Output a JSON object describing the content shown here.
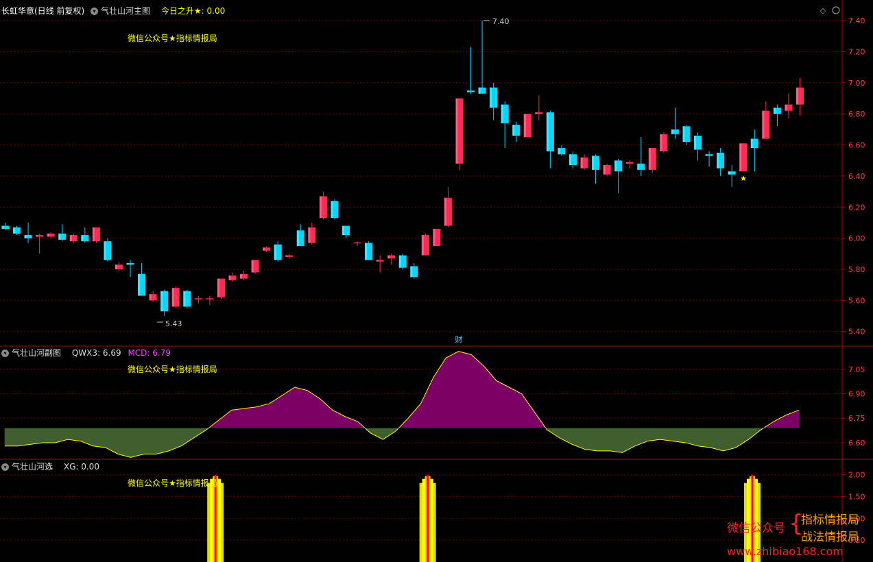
{
  "main_panel": {
    "stock_title": "长虹华意(日线 前复权)",
    "indicator_name": "气壮山河主图",
    "readout_label": "今日之升★:",
    "readout_value": "0.00",
    "watermark": "微信公众号★指标情报局",
    "finance_badge": "财",
    "high_label": "7.40",
    "low_label": "5.43",
    "y_ticks": [
      "7.40",
      "7.20",
      "7.00",
      "6.80",
      "6.60",
      "6.40",
      "6.20",
      "6.00",
      "5.80",
      "5.60",
      "5.40"
    ]
  },
  "sub_panel": {
    "indicator_name": "气壮山河副图",
    "qwx3_label": "QWX3:",
    "qwx3_value": "6.69",
    "mcd_label": "MCD:",
    "mcd_value": "6.79",
    "watermark": "微信公众号★指标情报局",
    "y_ticks": [
      "7.05",
      "6.90",
      "6.75",
      "6.60"
    ]
  },
  "select_panel": {
    "indicator_name": "气壮山河选",
    "xg_label": "XG:",
    "xg_value": "0.00",
    "watermark": "微信公众号★指标情报局",
    "y_ticks": [
      "2.00",
      "1.50",
      "1.00",
      "0.50"
    ]
  },
  "brand": {
    "left": "微信公众号",
    "brace": "{",
    "line1": "指标情报局",
    "line2": "战法情报局",
    "url": "www.zhibiao168.com"
  },
  "colors": {
    "up": "#ff2a55",
    "down": "#00d8ff",
    "green": "#00c000",
    "yellow": "#ffff00",
    "magenta": "#ff40ff",
    "area_up": "#7a0066",
    "area_down": "#3f5f2e",
    "panel_border": "#b00000"
  },
  "chart_data": [
    {
      "type": "candlestick",
      "title": "长虹华意(日线 前复权)",
      "ylim": [
        5.35,
        7.48
      ],
      "ohlc": [
        [
          6.08,
          6.1,
          6.05,
          6.06
        ],
        [
          6.07,
          6.08,
          6.02,
          6.03
        ],
        [
          6.02,
          6.1,
          5.97,
          6.0
        ],
        [
          6.01,
          6.03,
          5.9,
          6.02
        ],
        [
          6.01,
          6.04,
          6.0,
          6.03
        ],
        [
          6.03,
          6.09,
          5.98,
          5.99
        ],
        [
          5.98,
          6.03,
          5.97,
          6.02
        ],
        [
          6.02,
          6.07,
          5.97,
          5.98
        ],
        [
          5.98,
          6.07,
          5.97,
          6.07
        ],
        [
          5.98,
          6.0,
          5.85,
          5.86
        ],
        [
          5.8,
          5.85,
          5.79,
          5.83
        ],
        [
          5.84,
          5.86,
          5.75,
          5.83
        ],
        [
          5.77,
          5.84,
          5.63,
          5.63
        ],
        [
          5.6,
          5.66,
          5.59,
          5.64
        ],
        [
          5.66,
          5.67,
          5.5,
          5.53
        ],
        [
          5.56,
          5.69,
          5.55,
          5.68
        ],
        [
          5.66,
          5.67,
          5.55,
          5.56
        ],
        [
          5.61,
          5.63,
          5.58,
          5.61
        ],
        [
          5.61,
          5.63,
          5.57,
          5.61
        ],
        [
          5.62,
          5.74,
          5.61,
          5.74
        ],
        [
          5.73,
          5.78,
          5.72,
          5.76
        ],
        [
          5.74,
          5.79,
          5.73,
          5.77
        ],
        [
          5.78,
          5.86,
          5.77,
          5.86
        ],
        [
          5.92,
          5.95,
          5.91,
          5.94
        ],
        [
          5.96,
          5.98,
          5.85,
          5.86
        ],
        [
          5.88,
          5.9,
          5.87,
          5.89
        ],
        [
          6.05,
          6.09,
          5.95,
          5.95
        ],
        [
          5.97,
          6.1,
          5.96,
          6.07
        ],
        [
          6.13,
          6.3,
          6.12,
          6.27
        ],
        [
          6.24,
          6.25,
          6.12,
          6.13
        ],
        [
          6.08,
          6.08,
          6.0,
          6.02
        ],
        [
          5.97,
          5.98,
          5.95,
          5.97
        ],
        [
          5.97,
          5.98,
          5.86,
          5.86
        ],
        [
          5.85,
          5.89,
          5.78,
          5.86
        ],
        [
          5.87,
          5.9,
          5.83,
          5.89
        ],
        [
          5.89,
          5.9,
          5.8,
          5.81
        ],
        [
          5.82,
          5.84,
          5.74,
          5.75
        ],
        [
          5.89,
          6.03,
          5.89,
          6.02
        ],
        [
          5.95,
          6.06,
          5.95,
          6.06
        ],
        [
          6.08,
          6.33,
          6.07,
          6.26
        ],
        [
          6.48,
          6.9,
          6.44,
          6.9
        ],
        [
          6.95,
          7.23,
          6.93,
          6.94
        ],
        [
          6.97,
          7.4,
          6.96,
          6.93
        ],
        [
          6.97,
          7.0,
          6.76,
          6.84
        ],
        [
          6.86,
          6.88,
          6.58,
          6.74
        ],
        [
          6.73,
          6.75,
          6.62,
          6.66
        ],
        [
          6.65,
          6.8,
          6.65,
          6.8
        ],
        [
          6.8,
          6.92,
          6.76,
          6.81
        ],
        [
          6.81,
          6.82,
          6.45,
          6.56
        ],
        [
          6.58,
          6.6,
          6.53,
          6.54
        ],
        [
          6.54,
          6.56,
          6.45,
          6.47
        ],
        [
          6.45,
          6.54,
          6.44,
          6.52
        ],
        [
          6.53,
          6.54,
          6.35,
          6.44
        ],
        [
          6.41,
          6.48,
          6.4,
          6.47
        ],
        [
          6.5,
          6.51,
          6.29,
          6.43
        ],
        [
          6.48,
          6.5,
          6.45,
          6.49
        ],
        [
          6.48,
          6.65,
          6.4,
          6.44
        ],
        [
          6.44,
          6.58,
          6.42,
          6.58
        ],
        [
          6.56,
          6.68,
          6.55,
          6.67
        ],
        [
          6.7,
          6.84,
          6.64,
          6.67
        ],
        [
          6.72,
          6.73,
          6.6,
          6.62
        ],
        [
          6.66,
          6.68,
          6.5,
          6.57
        ],
        [
          6.54,
          6.56,
          6.46,
          6.53
        ],
        [
          6.55,
          6.58,
          6.4,
          6.45
        ],
        [
          6.43,
          6.47,
          6.33,
          6.41
        ],
        [
          6.43,
          6.6,
          6.43,
          6.61
        ],
        [
          6.64,
          6.7,
          6.43,
          6.58
        ],
        [
          6.64,
          6.88,
          6.64,
          6.82
        ],
        [
          6.84,
          6.86,
          6.72,
          6.8
        ],
        [
          6.82,
          6.93,
          6.77,
          6.86
        ],
        [
          6.86,
          7.03,
          6.79,
          6.97
        ]
      ]
    },
    {
      "type": "area",
      "title": "气壮山河副图",
      "ylim": [
        6.52,
        7.15
      ],
      "baseline": 6.69,
      "series": [
        {
          "name": "MCD",
          "values": [
            6.58,
            6.58,
            6.59,
            6.6,
            6.6,
            6.62,
            6.61,
            6.58,
            6.57,
            6.53,
            6.51,
            6.53,
            6.53,
            6.55,
            6.58,
            6.63,
            6.68,
            6.74,
            6.8,
            6.81,
            6.82,
            6.84,
            6.89,
            6.94,
            6.92,
            6.87,
            6.8,
            6.76,
            6.73,
            6.66,
            6.62,
            6.67,
            6.75,
            6.84,
            7.0,
            7.12,
            7.16,
            7.14,
            7.07,
            6.98,
            6.94,
            6.9,
            6.79,
            6.68,
            6.63,
            6.59,
            6.56,
            6.55,
            6.55,
            6.54,
            6.58,
            6.61,
            6.62,
            6.61,
            6.6,
            6.58,
            6.57,
            6.55,
            6.57,
            6.62,
            6.68,
            6.73,
            6.77,
            6.8
          ]
        }
      ]
    },
    {
      "type": "bar",
      "title": "气壮山河选",
      "ylim": [
        0,
        2.2
      ],
      "values": [
        {
          "pos": 18.5,
          "value": 2.0
        },
        {
          "pos": 37.2,
          "value": 2.0
        },
        {
          "pos": 65.8,
          "value": 2.0
        }
      ]
    }
  ]
}
